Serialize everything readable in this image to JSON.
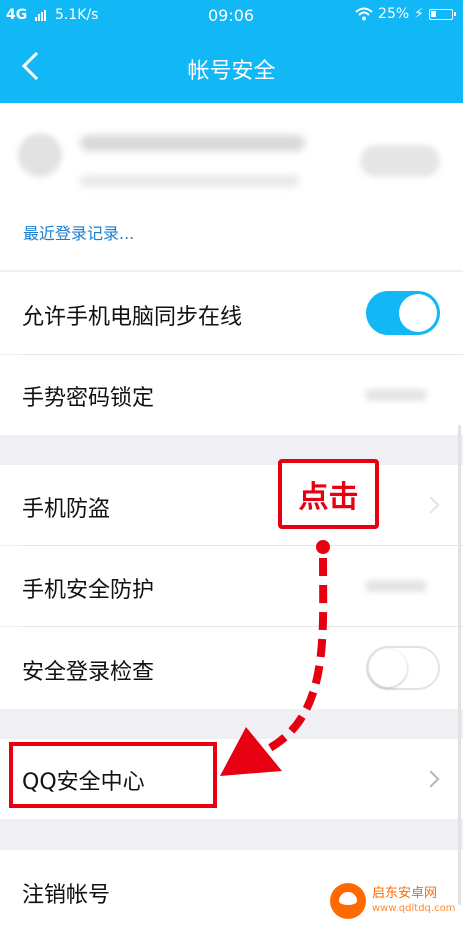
{
  "status_bar": {
    "network": "4G",
    "speed": "5.1K/s",
    "time": "09:06",
    "battery": "25%"
  },
  "header": {
    "title": "帐号安全",
    "back_icon": "chevron-left-icon",
    "background": "#12b7f5"
  },
  "device_card": {
    "recent_login_link": "最近登录记录..."
  },
  "settings": {
    "allow_sync": {
      "label": "允许手机电脑同步在线",
      "toggle_on": true
    },
    "gesture_lock": {
      "label": "手势密码锁定"
    },
    "anti_theft": {
      "label": "手机防盗"
    },
    "phone_protect": {
      "label": "手机安全防护"
    },
    "login_check": {
      "label": "安全登录检查",
      "toggle_on": false
    },
    "qq_security": {
      "label": "QQ安全中心"
    },
    "cancel_account": {
      "label": "注销帐号"
    }
  },
  "annotation": {
    "tap_label": "点击",
    "accent": "#e60012"
  },
  "watermark": {
    "brand": "启东安卓网",
    "url": "www.qdltdq.com"
  }
}
